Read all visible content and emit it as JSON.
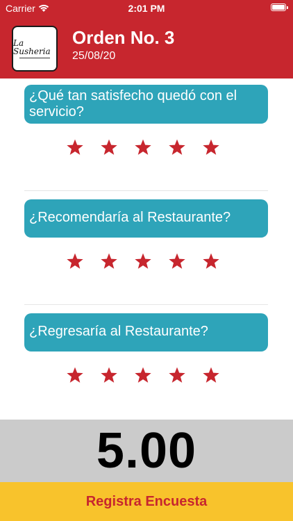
{
  "status_bar": {
    "carrier": "Carrier",
    "time": "2:01 PM"
  },
  "header": {
    "order_title": "Orden No. 3",
    "date": "25/08/20",
    "logo_text": "La Susheria"
  },
  "questions": [
    {
      "text": "¿Qué tan satisfecho quedó con el servicio?",
      "rating": 5,
      "max": 5
    },
    {
      "text": "¿Recomendaría al Restaurante?",
      "rating": 5,
      "max": 5
    },
    {
      "text": "¿Regresaría al Restaurante?",
      "rating": 5,
      "max": 5
    }
  ],
  "score": "5.00",
  "submit_label": "Registra Encuesta",
  "colors": {
    "header": "#c7262e",
    "card": "#2ea4b9",
    "star": "#c7262e",
    "score_bg": "#cbcbcb",
    "button_bg": "#f8c32c",
    "button_text": "#c7262e"
  }
}
